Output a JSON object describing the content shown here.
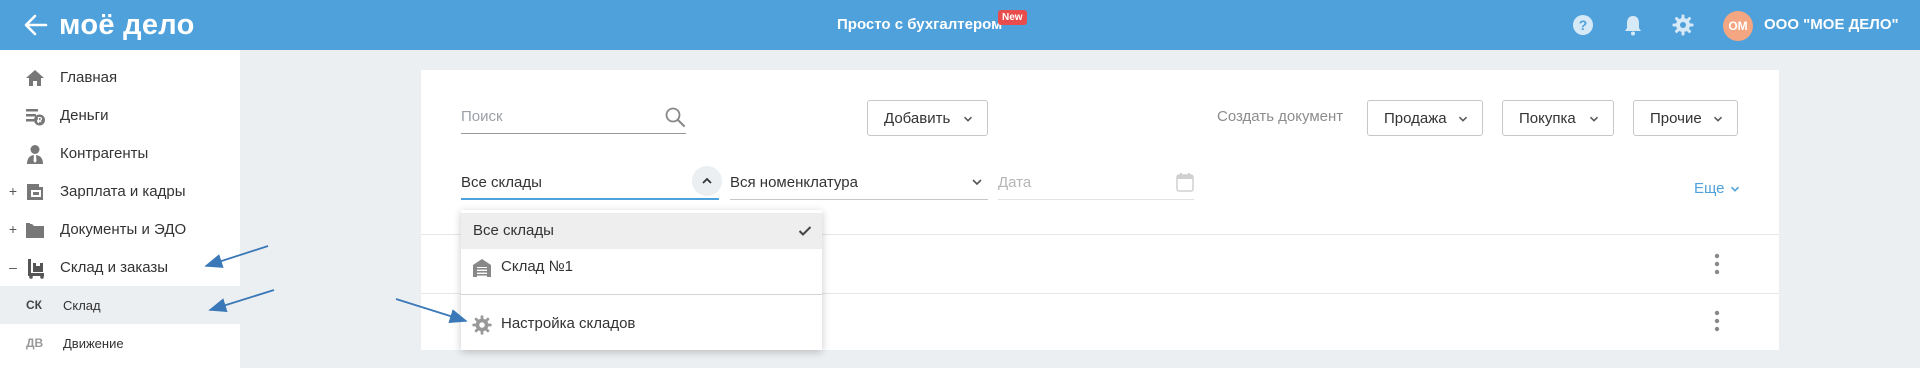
{
  "header": {
    "logo": "моё дело",
    "promo": "Просто с бухгалтером",
    "new_badge": "New",
    "avatar_initials": "ОМ",
    "org_name": "ООО \"МОЕ ДЕЛО\"",
    "icons": [
      "back-arrow-icon",
      "help-icon",
      "bell-icon",
      "gear-icon"
    ]
  },
  "sidebar": {
    "items": [
      {
        "label": "Главная",
        "icon": "home-icon",
        "toggle": ""
      },
      {
        "label": "Деньги",
        "icon": "money-icon",
        "toggle": ""
      },
      {
        "label": "Контрагенты",
        "icon": "contractors-icon",
        "toggle": ""
      },
      {
        "label": "Зарплата и кадры",
        "icon": "salary-icon",
        "toggle": "+"
      },
      {
        "label": "Документы и ЭДО",
        "icon": "documents-icon",
        "toggle": "+"
      },
      {
        "label": "Склад и заказы",
        "icon": "warehouse-icon",
        "toggle": "–"
      }
    ],
    "subitems": [
      {
        "abbr": "СК",
        "label": "Склад",
        "active": true
      },
      {
        "abbr": "ДВ",
        "label": "Движение",
        "active": false
      }
    ]
  },
  "toolbar": {
    "search_placeholder": "Поиск",
    "add_label": "Добавить",
    "create_doc_label": "Создать документ",
    "sale_label": "Продажа",
    "purchase_label": "Покупка",
    "other_label": "Прочие"
  },
  "filters": {
    "warehouse_value": "Все склады",
    "nomenclature_value": "Вся номенклатура",
    "date_placeholder": "Дата",
    "more_label": "Еще"
  },
  "dropdown": {
    "options": [
      {
        "label": "Все склады",
        "selected": true
      },
      {
        "label": "Склад №1",
        "icon": "warehouse-building-icon"
      }
    ],
    "settings_label": "Настройка складов",
    "settings_icon": "gear-icon"
  },
  "colors": {
    "header_bg": "#4fa1db",
    "accent": "#4fa1db",
    "badge": "#e84c4c",
    "avatar": "#f4a582",
    "annotation_arrow": "#3a78b8"
  }
}
